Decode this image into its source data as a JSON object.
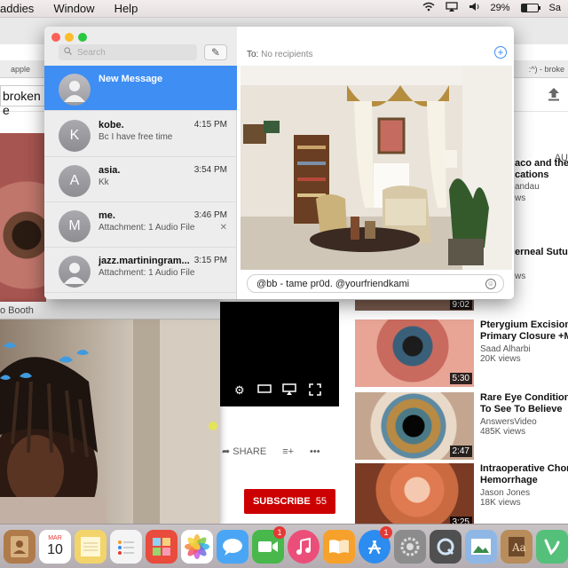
{
  "menubar": {
    "app_partial": "addies",
    "items": [
      "Window",
      "Help"
    ],
    "battery": "29%",
    "clock_partial": "Sa"
  },
  "browser": {
    "tab_left": "apple",
    "tab_right": ":^) - broke",
    "search_value": "broken e",
    "autoplay_label": "AU",
    "actions": {
      "share": "SHARE"
    },
    "subscribe": {
      "label": "SUBSCRIBE",
      "count": "55"
    },
    "recommended": [
      {
        "title": "Pterygium Excision",
        "title2": "Primary Closure +M",
        "channel": "Saad Alharbi",
        "views": "20K views",
        "duration": "5:30"
      },
      {
        "title": "Rare Eye Conditions",
        "title2": "To See To Believe",
        "channel": "AnswersVideo",
        "views": "485K views",
        "duration": "2:47"
      },
      {
        "title": "Intraoperative Chor",
        "title2": "Hemorrhage",
        "channel": "Jason Jones",
        "views": "18K views",
        "duration": "3:25"
      }
    ],
    "clipped_top": [
      "aco and ther",
      "cations",
      "andau",
      "ws"
    ],
    "clipped_mid": [
      "erneal Suture",
      "ws"
    ],
    "clipped_dur": "9:02"
  },
  "photobooth": {
    "title_partial": "o Booth"
  },
  "messages": {
    "search_placeholder": "Search",
    "to_label": "To:",
    "to_placeholder": "No recipients",
    "compose_text": "@bb - tame pr0d. @yourfriendkami",
    "conversations": [
      {
        "initial": "",
        "name": "New Message",
        "time": "",
        "preview": "",
        "selected": true
      },
      {
        "initial": "K",
        "name": "kobe.",
        "time": "4:15 PM",
        "preview": "Bc I have free time"
      },
      {
        "initial": "A",
        "name": "asia.",
        "time": "3:54 PM",
        "preview": "Kk"
      },
      {
        "initial": "M",
        "name": "me.",
        "time": "3:46 PM",
        "preview": "Attachment: 1 Audio File"
      },
      {
        "initial": "",
        "name": "jazz.martiningram...",
        "time": "3:15 PM",
        "preview": "Attachment: 1 Audio File"
      }
    ]
  },
  "dock": {
    "items": [
      {
        "name": "contacts",
        "color": "#b07b4b"
      },
      {
        "name": "calendar",
        "color": "#ffffff",
        "month": "MAR",
        "day": "10"
      },
      {
        "name": "notes",
        "color": "#f2d46a"
      },
      {
        "name": "reminders",
        "color": "#f4f4f4"
      },
      {
        "name": "photo-booth",
        "color": "#e94b3c"
      },
      {
        "name": "photos",
        "color": "#ffffff"
      },
      {
        "name": "messages",
        "color": "#4aa6f5"
      },
      {
        "name": "facetime",
        "color": "#49b84c",
        "badge": "1"
      },
      {
        "name": "itunes",
        "color": "#ec4e7a"
      },
      {
        "name": "ibooks",
        "color": "#f6a12b"
      },
      {
        "name": "app-store",
        "color": "#2d8cf0",
        "badge": "1"
      },
      {
        "name": "system-preferences",
        "color": "#8c8c8c"
      },
      {
        "name": "quicktime",
        "color": "#505050"
      },
      {
        "name": "preview",
        "color": "#8fb7e6"
      },
      {
        "name": "dictionary",
        "color": "#b88d5b"
      },
      {
        "name": "vine",
        "color": "#55c07a"
      }
    ]
  }
}
